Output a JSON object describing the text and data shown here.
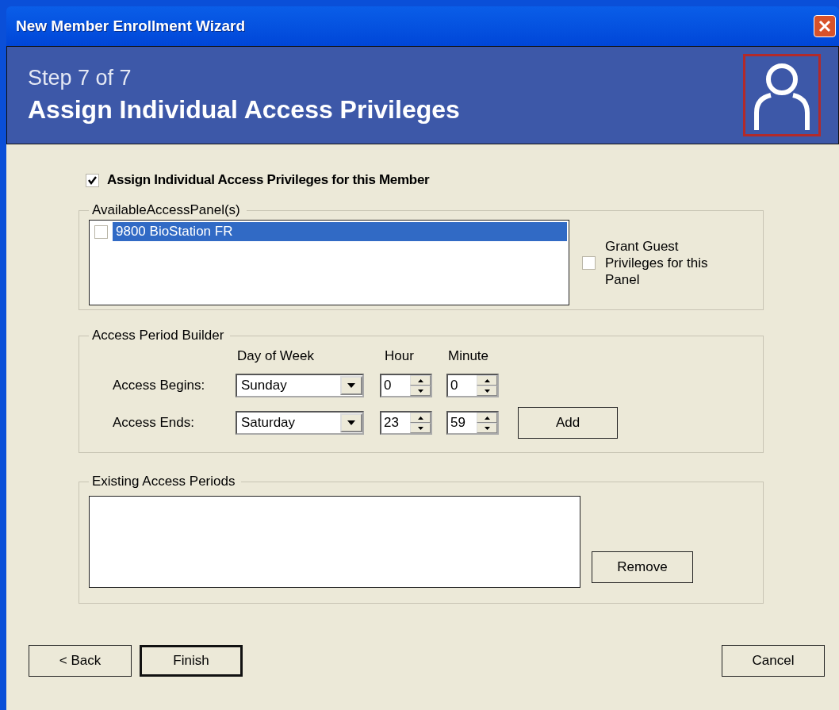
{
  "window": {
    "title": "New Member Enrollment Wizard"
  },
  "header": {
    "step": "Step 7 of 7",
    "title": "Assign Individual Access Privileges"
  },
  "assign_checkbox": {
    "label": "Assign Individual Access Privileges for this Member",
    "checked": true
  },
  "available_panels": {
    "legend": "AvailableAccessPanel(s)",
    "items": [
      {
        "label": "9800 BioStation FR",
        "checked": false,
        "selected": true
      }
    ],
    "guest_checkbox": {
      "label": "Grant Guest Privileges for this Panel",
      "checked": false
    }
  },
  "period_builder": {
    "legend": "Access Period Builder",
    "columns": [
      "Day of Week",
      "Hour",
      "Minute"
    ],
    "rows": [
      {
        "label": "Access Begins:",
        "day": "Sunday",
        "hour": "0",
        "minute": "0"
      },
      {
        "label": "Access Ends:",
        "day": "Saturday",
        "hour": "23",
        "minute": "59"
      }
    ],
    "add_button": "Add"
  },
  "existing_periods": {
    "legend": "Existing Access Periods",
    "remove_button": "Remove"
  },
  "buttons": {
    "back": "< Back",
    "finish": "Finish",
    "cancel": "Cancel"
  }
}
